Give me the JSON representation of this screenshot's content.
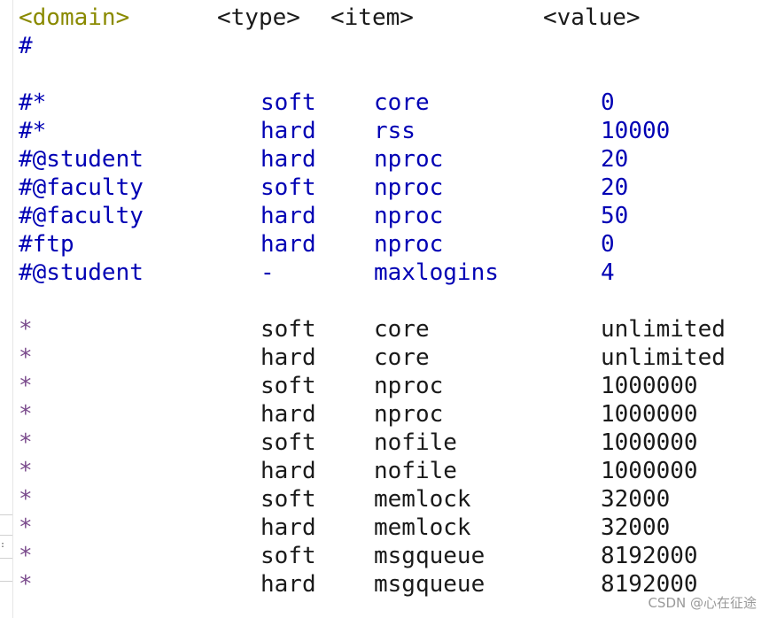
{
  "colors": {
    "domain_header": "#8a8a00",
    "header_text": "#1a1a1a",
    "commented_entries": "#0000b4",
    "wildcard_domain": "#7a4a8c",
    "active_values": "#1a1a1a"
  },
  "header": {
    "domain": "<domain>",
    "type": "<type>",
    "item": "<item>",
    "value": "<value>"
  },
  "comment_hash": "#",
  "commented_rows": [
    {
      "domain": "#*",
      "type": "soft",
      "item": "core",
      "value": "0"
    },
    {
      "domain": "#*",
      "type": "hard",
      "item": "rss",
      "value": "10000"
    },
    {
      "domain": "#@student",
      "type": "hard",
      "item": "nproc",
      "value": "20"
    },
    {
      "domain": "#@faculty",
      "type": "soft",
      "item": "nproc",
      "value": "20"
    },
    {
      "domain": "#@faculty",
      "type": "hard",
      "item": "nproc",
      "value": "50"
    },
    {
      "domain": "#ftp",
      "type": "hard",
      "item": "nproc",
      "value": "0"
    },
    {
      "domain": "#@student",
      "type": "-",
      "item": "maxlogins",
      "value": "4"
    }
  ],
  "active_rows": [
    {
      "domain": "*",
      "type": "soft",
      "item": "core",
      "value": "unlimited"
    },
    {
      "domain": "*",
      "type": "hard",
      "item": "core",
      "value": "unlimited"
    },
    {
      "domain": "*",
      "type": "soft",
      "item": "nproc",
      "value": "1000000"
    },
    {
      "domain": "*",
      "type": "hard",
      "item": "nproc",
      "value": "1000000"
    },
    {
      "domain": "*",
      "type": "soft",
      "item": "nofile",
      "value": "1000000"
    },
    {
      "domain": "*",
      "type": "hard",
      "item": "nofile",
      "value": "1000000"
    },
    {
      "domain": "*",
      "type": "soft",
      "item": "memlock",
      "value": "32000"
    },
    {
      "domain": "*",
      "type": "hard",
      "item": "memlock",
      "value": "32000"
    },
    {
      "domain": "*",
      "type": "soft",
      "item": "msgqueue",
      "value": "8192000"
    },
    {
      "domain": "*",
      "type": "hard",
      "item": "msgqueue",
      "value": "8192000"
    }
  ],
  "gutter_dots": ":",
  "watermark": "CSDN @心在征途"
}
